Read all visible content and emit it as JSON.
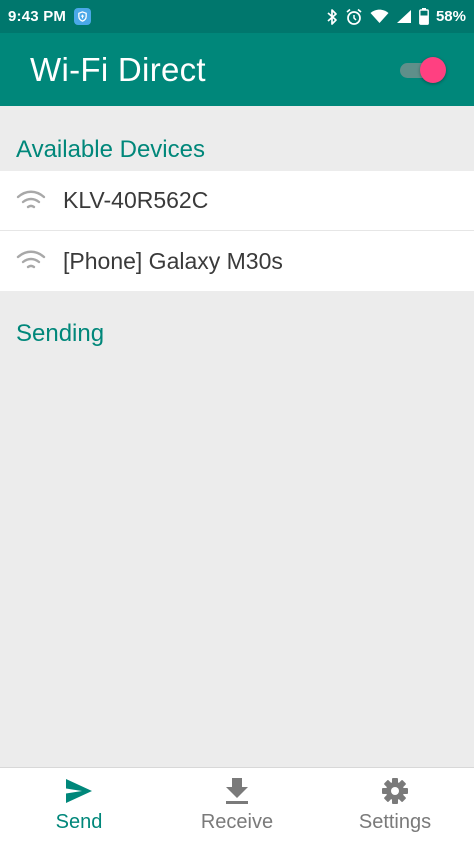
{
  "status_bar": {
    "time": "9:43 PM",
    "battery": "58%",
    "icons": [
      "shield-icon",
      "bluetooth-icon",
      "alarm-icon",
      "wifi-icon",
      "cellular-icon",
      "battery-icon"
    ]
  },
  "app_bar": {
    "title": "Wi-Fi Direct",
    "wifi_direct_enabled": true
  },
  "sections": {
    "available": "Available Devices",
    "sending": "Sending"
  },
  "devices": [
    {
      "name": "KLV-40R562C",
      "icon": "wifi-icon"
    },
    {
      "name": "[Phone] Galaxy M30s",
      "icon": "wifi-icon"
    }
  ],
  "bottom_nav": {
    "items": [
      {
        "label": "Send",
        "icon": "send-icon",
        "active": true
      },
      {
        "label": "Receive",
        "icon": "download-icon",
        "active": false
      },
      {
        "label": "Settings",
        "icon": "gear-icon",
        "active": false
      }
    ]
  },
  "colors": {
    "status_bar": "#00776d",
    "app_bar": "#00877a",
    "accent": "#ff4081",
    "section_text": "#00877a",
    "background": "#ececec"
  }
}
